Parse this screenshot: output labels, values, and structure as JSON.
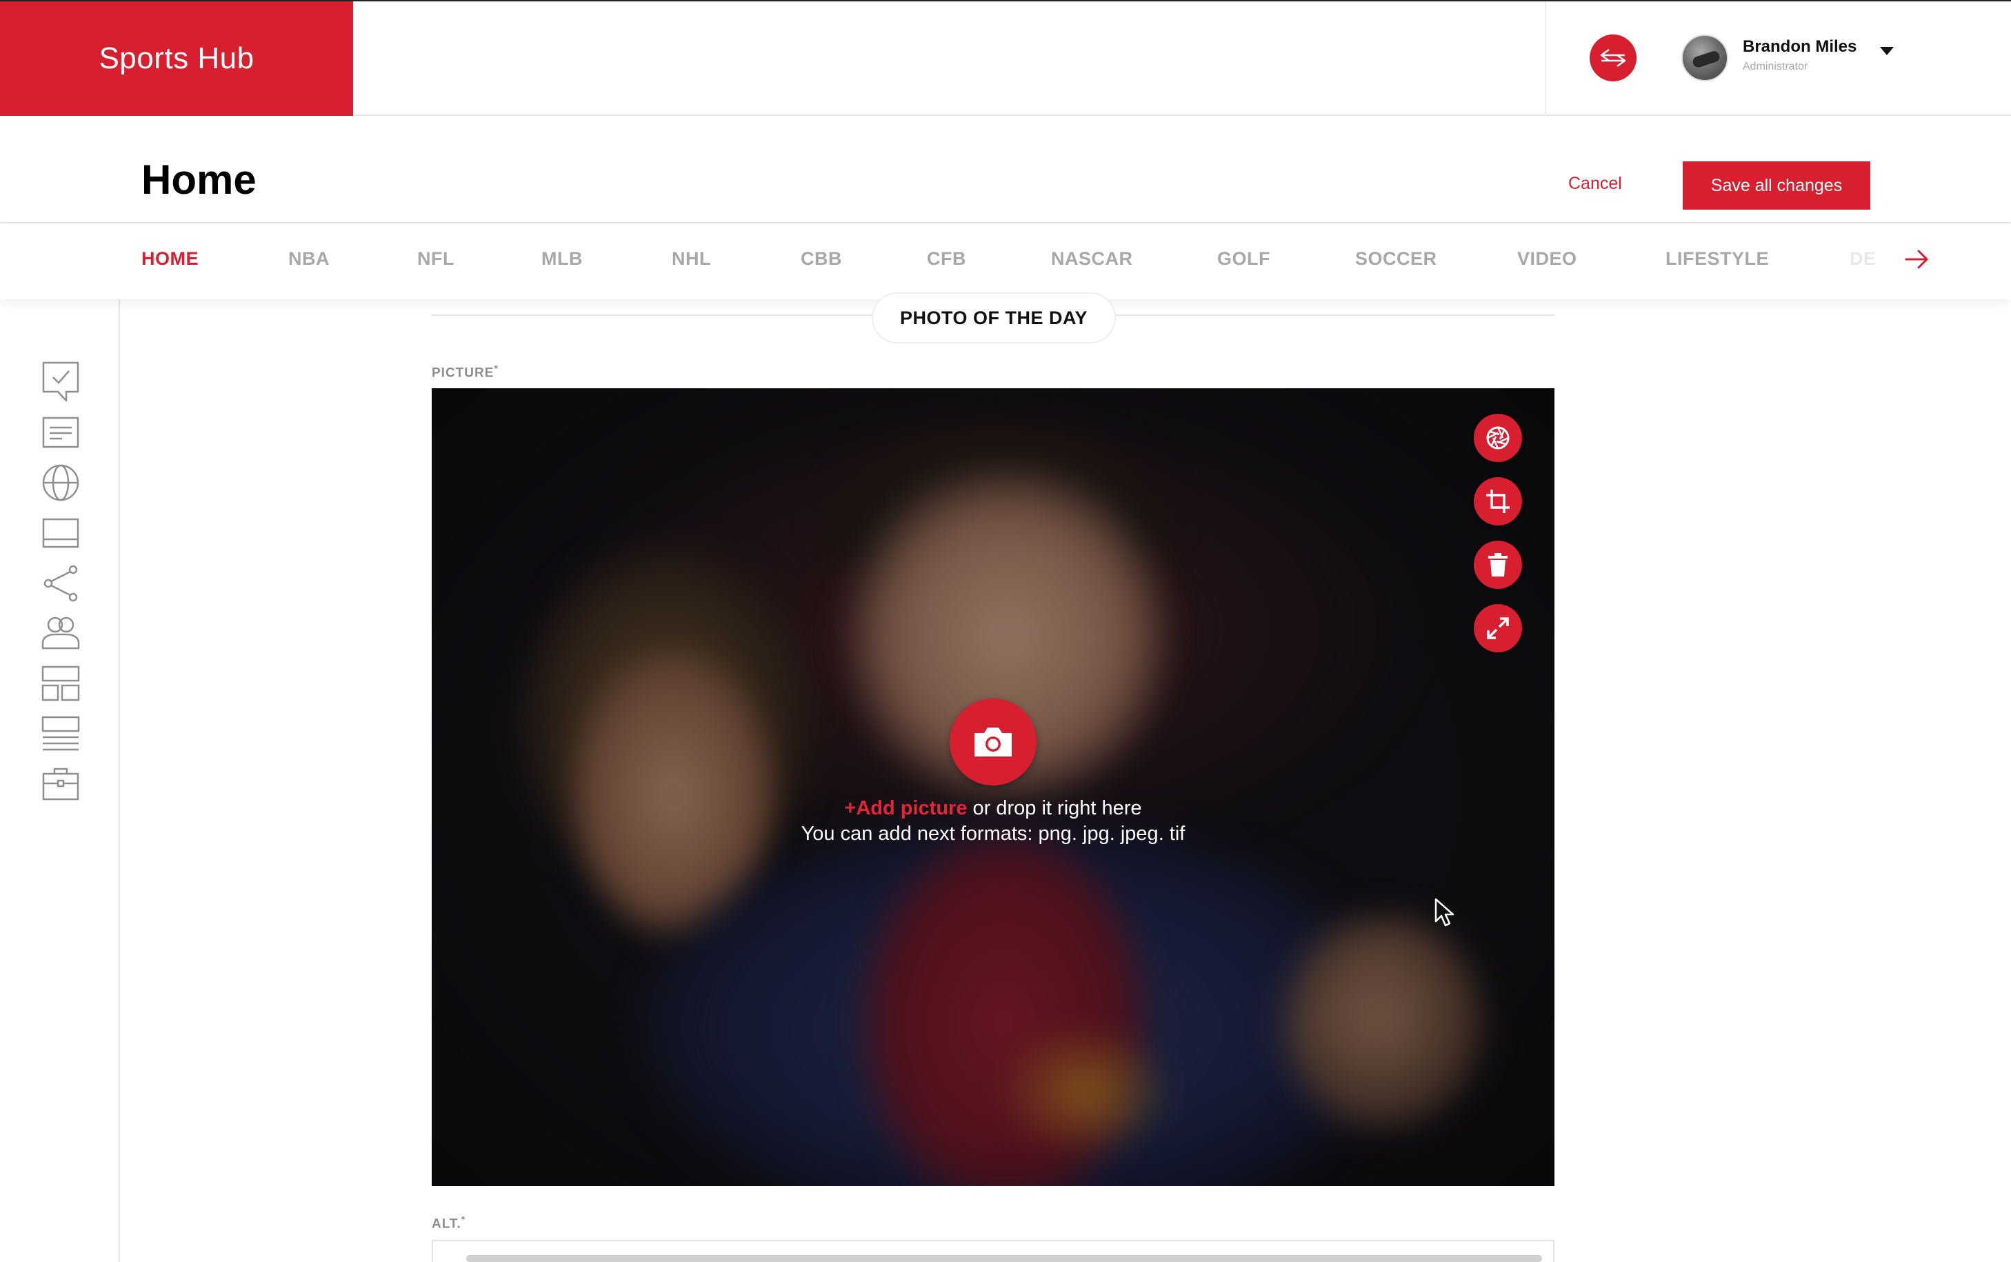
{
  "header": {
    "brand": "Sports Hub",
    "user": {
      "name": "Brandon Miles",
      "role": "Administrator"
    }
  },
  "page": {
    "title": "Home",
    "cancel_label": "Cancel",
    "save_label": "Save all changes"
  },
  "tabs": {
    "items": [
      "HOME",
      "NBA",
      "NFL",
      "MLB",
      "NHL",
      "CBB",
      "CFB",
      "NASCAR",
      "GOLF",
      "SOCCER",
      "VIDEO",
      "LIFESTYLE",
      "DEALBOOK"
    ],
    "active": "HOME"
  },
  "sidebar": {
    "icons": [
      "survey-icon",
      "article-icon",
      "globe-icon",
      "banner-icon",
      "share-icon",
      "users-icon",
      "layout-icon",
      "list-icon",
      "briefcase-icon"
    ]
  },
  "section": {
    "title": "PHOTO OF THE DAY",
    "picture_label": "PICTURE",
    "alt_label": "ALT.",
    "required_mark": "*"
  },
  "upload": {
    "add_link": "+Add picture",
    "drop_text": " or drop it right here",
    "formats_text": "You can add next formats: png. jpg. jpeg. tif"
  },
  "tools": [
    "aperture-icon",
    "crop-icon",
    "trash-icon",
    "expand-icon"
  ],
  "colors": {
    "accent": "#d71f30",
    "muted": "#a8a8a8",
    "border": "#e6e6e6"
  }
}
